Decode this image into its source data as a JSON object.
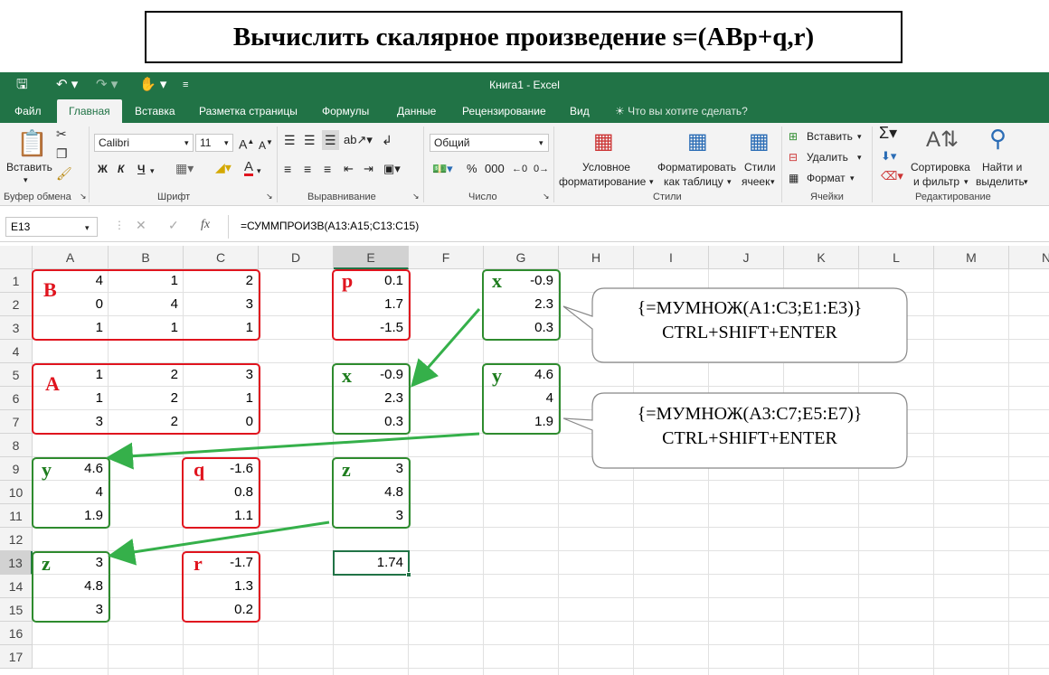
{
  "title": "Вычислить скалярное произведение s=(ABp+q,r)",
  "window": {
    "title": "Книга1 - Excel",
    "save_icon": "save-icon",
    "undo_icon": "undo-icon",
    "redo_icon": "redo-icon",
    "touch_icon": "touch-icon",
    "customize_icon": "customize-icon"
  },
  "tabs": [
    {
      "label": "Файл"
    },
    {
      "label": "Главная"
    },
    {
      "label": "Вставка"
    },
    {
      "label": "Разметка страницы"
    },
    {
      "label": "Формулы"
    },
    {
      "label": "Данные"
    },
    {
      "label": "Рецензирование"
    },
    {
      "label": "Вид"
    },
    {
      "label": "Что вы хотите сделать?"
    }
  ],
  "ribbon": {
    "clipboard": {
      "label": "Буфер обмена",
      "paste": "Вставить"
    },
    "font": {
      "label": "Шрифт",
      "name": "Calibri",
      "size": "11",
      "bold": "Ж",
      "italic": "К",
      "underline": "Ч"
    },
    "alignment": {
      "label": "Выравнивание"
    },
    "number": {
      "label": "Число",
      "format": "Общий"
    },
    "styles": {
      "label": "Стили",
      "cond_l1": "Условное",
      "cond_l2": "форматирование",
      "table_l1": "Форматировать",
      "table_l2": "как таблицу",
      "cell_l1": "Стили",
      "cell_l2": "ячеек"
    },
    "cells": {
      "label": "Ячейки",
      "insert": "Вставить",
      "delete": "Удалить",
      "format": "Формат"
    },
    "editing": {
      "label": "Редактирование",
      "sort_l1": "Сортировка",
      "sort_l2": "и фильтр",
      "find_l1": "Найти и",
      "find_l2": "выделить"
    }
  },
  "formula_bar": {
    "name_box": "E13",
    "fx": "fx",
    "formula": "=СУММПРОИЗВ(A13:A15;C13:C15)"
  },
  "columns": [
    "A",
    "B",
    "C",
    "D",
    "E",
    "F",
    "G",
    "H",
    "I",
    "J",
    "K",
    "L",
    "M",
    "N"
  ],
  "rows": [
    "1",
    "2",
    "3",
    "4",
    "5",
    "6",
    "7",
    "8",
    "9",
    "10",
    "11",
    "12",
    "13",
    "14",
    "15",
    "16",
    "17"
  ],
  "cells": {
    "A1": "4",
    "B1": "1",
    "C1": "2",
    "A2": "0",
    "B2": "4",
    "C2": "3",
    "A3": "1",
    "B3": "1",
    "C3": "1",
    "A5": "1",
    "B5": "2",
    "C5": "3",
    "A6": "1",
    "B6": "2",
    "C6": "1",
    "A7": "3",
    "B7": "2",
    "C7": "0",
    "A9": "4.6",
    "A10": "4",
    "A11": "1.9",
    "C9": "-1.6",
    "C10": "0.8",
    "C11": "1.1",
    "A13": "3",
    "A14": "4.8",
    "A15": "3",
    "C13": "-1.7",
    "C14": "1.3",
    "C15": "0.2",
    "E1": "0.1",
    "E2": "1.7",
    "E3": "-1.5",
    "E5": "-0.9",
    "E6": "2.3",
    "E7": "0.3",
    "E9": "3",
    "E10": "4.8",
    "E11": "3",
    "E13": "1.74",
    "G1": "-0.9",
    "G2": "2.3",
    "G3": "0.3",
    "G5": "4.6",
    "G6": "4",
    "G7": "1.9"
  },
  "labels": {
    "B": "B",
    "A": "A",
    "p": "p",
    "x1": "x",
    "x2": "x",
    "y1": "y",
    "y2": "y",
    "q": "q",
    "z1": "z",
    "z2": "z",
    "r": "r"
  },
  "callouts": [
    {
      "line1": "{=МУМНОЖ(A1:C3;E1:E3)}",
      "line2": "CTRL+SHIFT+ENTER"
    },
    {
      "line1": "{=МУМНОЖ(A3:C7;E5:E7)}",
      "line2": "CTRL+SHIFT+ENTER"
    }
  ],
  "colors": {
    "excel_green": "#217346",
    "red": "#e0141e",
    "green": "#2e8b2e",
    "arrow": "#35b04a"
  }
}
